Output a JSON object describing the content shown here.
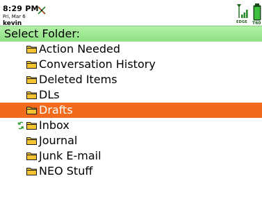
{
  "status_bar": {
    "time": "8:29 PM",
    "date": "Fri, Mar 6",
    "profile": "kevin",
    "network": "EDGE",
    "battery_label": "T60"
  },
  "header": {
    "title": "Select Folder:"
  },
  "folders": [
    {
      "label": "Action Needed",
      "selected": false,
      "sync": false
    },
    {
      "label": "Conversation History",
      "selected": false,
      "sync": false
    },
    {
      "label": "Deleted Items",
      "selected": false,
      "sync": false
    },
    {
      "label": "DLs",
      "selected": false,
      "sync": false
    },
    {
      "label": "Drafts",
      "selected": true,
      "sync": false
    },
    {
      "label": "Inbox",
      "selected": false,
      "sync": true
    },
    {
      "label": "Journal",
      "selected": false,
      "sync": false
    },
    {
      "label": "Junk E-mail",
      "selected": false,
      "sync": false
    },
    {
      "label": "NEO Stuff",
      "selected": false,
      "sync": false
    }
  ],
  "icons": {
    "call": "missed-call-icon",
    "signal": "signal-strength-icon",
    "battery": "battery-icon",
    "folder": "folder-icon",
    "sync": "sync-icon"
  },
  "colors": {
    "header_bg": "#9fe892",
    "selection_bg": "#f26a1b",
    "folder_yellow": "#e9b320"
  }
}
